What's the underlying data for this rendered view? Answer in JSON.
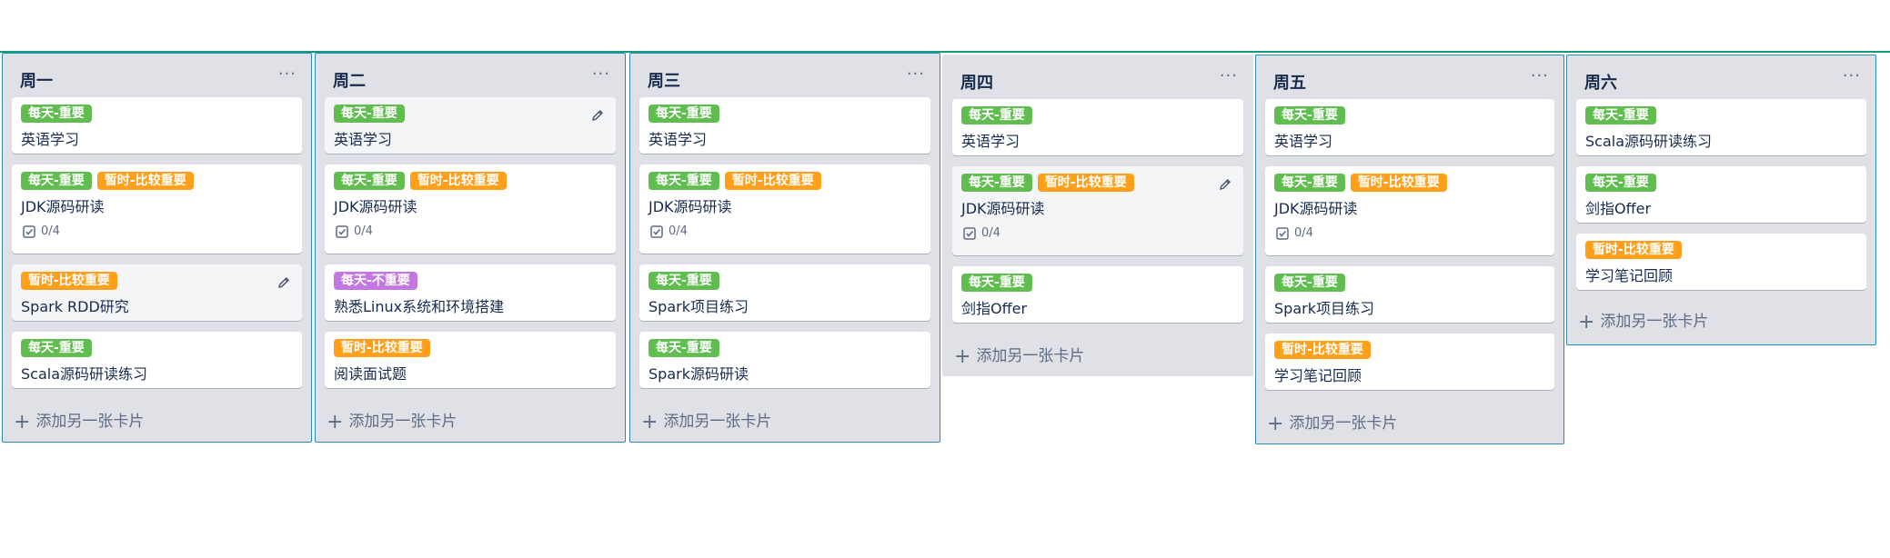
{
  "add_card_label": "添加另一张卡片",
  "menu_glyph": "···",
  "lists": [
    {
      "title": "周一",
      "cards": [
        {
          "labels": [
            {
              "text": "每天-重要",
              "color": "green"
            }
          ],
          "title": "英语学习"
        },
        {
          "labels": [
            {
              "text": "每天-重要",
              "color": "green"
            },
            {
              "text": "暂时-比较重要",
              "color": "orange"
            }
          ],
          "title": "JDK源码研读",
          "checklist": "0/4"
        },
        {
          "labels": [
            {
              "text": "暂时-比较重要",
              "color": "orange"
            }
          ],
          "title": "Spark RDD研究"
        },
        {
          "labels": [
            {
              "text": "每天-重要",
              "color": "green"
            }
          ],
          "title": "Scala源码研读练习"
        }
      ]
    },
    {
      "title": "周二",
      "cards": [
        {
          "labels": [
            {
              "text": "每天-重要",
              "color": "green"
            }
          ],
          "title": "英语学习"
        },
        {
          "labels": [
            {
              "text": "每天-重要",
              "color": "green"
            },
            {
              "text": "暂时-比较重要",
              "color": "orange"
            }
          ],
          "title": "JDK源码研读",
          "checklist": "0/4"
        },
        {
          "labels": [
            {
              "text": "每天-不重要",
              "color": "purple"
            }
          ],
          "title": "熟悉Linux系统和环境搭建"
        },
        {
          "labels": [
            {
              "text": "暂时-比较重要",
              "color": "orange"
            }
          ],
          "title": "阅读面试题"
        }
      ]
    },
    {
      "title": "周三",
      "cards": [
        {
          "labels": [
            {
              "text": "每天-重要",
              "color": "green"
            }
          ],
          "title": "英语学习"
        },
        {
          "labels": [
            {
              "text": "每天-重要",
              "color": "green"
            },
            {
              "text": "暂时-比较重要",
              "color": "orange"
            }
          ],
          "title": "JDK源码研读",
          "checklist": "0/4"
        },
        {
          "labels": [
            {
              "text": "每天-重要",
              "color": "green"
            }
          ],
          "title": "Spark项目练习"
        },
        {
          "labels": [
            {
              "text": "每天-重要",
              "color": "green"
            }
          ],
          "title": "Spark源码研读"
        }
      ]
    },
    {
      "title": "周四",
      "cards": [
        {
          "labels": [
            {
              "text": "每天-重要",
              "color": "green"
            }
          ],
          "title": "英语学习"
        },
        {
          "labels": [
            {
              "text": "每天-重要",
              "color": "green"
            },
            {
              "text": "暂时-比较重要",
              "color": "orange"
            }
          ],
          "title": "JDK源码研读",
          "checklist": "0/4"
        },
        {
          "labels": [
            {
              "text": "每天-重要",
              "color": "green"
            }
          ],
          "title": "剑指Offer"
        }
      ]
    },
    {
      "title": "周五",
      "cards": [
        {
          "labels": [
            {
              "text": "每天-重要",
              "color": "green"
            }
          ],
          "title": "英语学习"
        },
        {
          "labels": [
            {
              "text": "每天-重要",
              "color": "green"
            },
            {
              "text": "暂时-比较重要",
              "color": "orange"
            }
          ],
          "title": "JDK源码研读",
          "checklist": "0/4"
        },
        {
          "labels": [
            {
              "text": "每天-重要",
              "color": "green"
            }
          ],
          "title": "Spark项目练习"
        },
        {
          "labels": [
            {
              "text": "暂时-比较重要",
              "color": "orange"
            }
          ],
          "title": "学习笔记回顾"
        }
      ]
    },
    {
      "title": "周六",
      "cards": [
        {
          "labels": [
            {
              "text": "每天-重要",
              "color": "green"
            }
          ],
          "title": "Scala源码研读练习"
        },
        {
          "labels": [
            {
              "text": "每天-重要",
              "color": "green"
            }
          ],
          "title": "剑指Offer"
        },
        {
          "labels": [
            {
              "text": "暂时-比较重要",
              "color": "orange"
            }
          ],
          "title": "学习笔记回顾"
        }
      ]
    }
  ],
  "colors": {
    "green": "#61bd4f",
    "orange": "#ff9f1a",
    "purple": "#c377e0",
    "list_bg": "#dfe1e6",
    "accent_line": "#0e9c7a"
  }
}
